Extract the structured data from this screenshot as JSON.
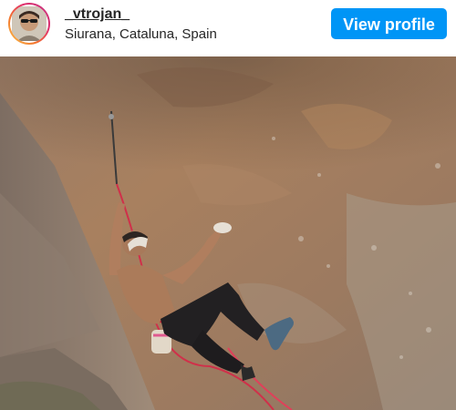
{
  "header": {
    "username": "_vtrojan_",
    "location": "Siurana, Cataluna, Spain",
    "view_profile_label": "View profile"
  },
  "colors": {
    "accent": "#0095f6",
    "text": "#262626"
  },
  "photo": {
    "subject": "climber-on-overhanging-rock"
  }
}
